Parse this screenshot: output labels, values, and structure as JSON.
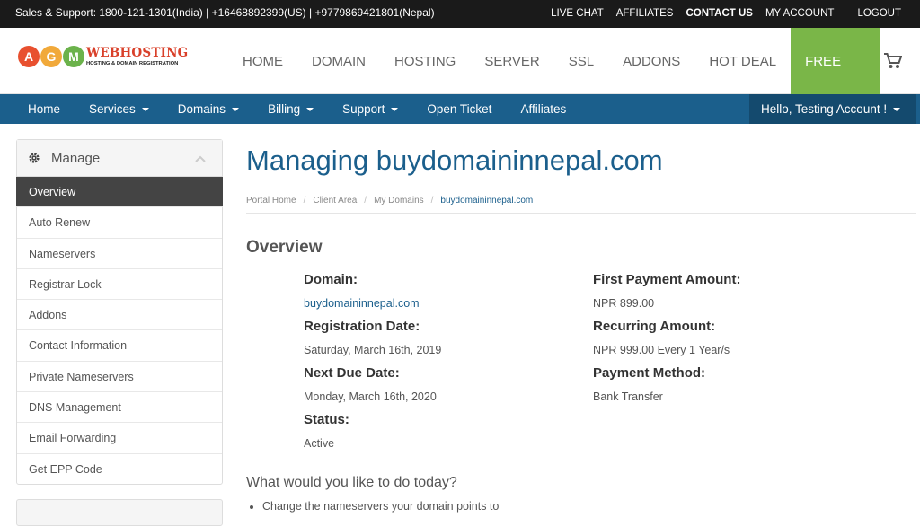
{
  "topbar": {
    "support": "Sales & Support: 1800-121-1301(India) | +16468892399(US) | +9779869421801(Nepal)",
    "links": [
      "LIVE CHAT",
      "AFFILIATES",
      "CONTACT US",
      "MY ACCOUNT",
      "LOGOUT"
    ]
  },
  "logo": {
    "letters": [
      "A",
      "G",
      "M"
    ],
    "letter_colors": [
      "#e8502f",
      "#f1a93a",
      "#6bb24b"
    ],
    "name": "WEBHOSTING",
    "tagline": "HOSTING & DOMAIN REGISTRATION"
  },
  "mainnav": [
    "HOME",
    "DOMAIN",
    "HOSTING",
    "SERVER",
    "SSL",
    "ADDONS",
    "HOT DEAL",
    "FREE TRAIL"
  ],
  "cart_icon": "cart-icon",
  "bluenav": {
    "items": [
      {
        "label": "Home",
        "dropdown": false
      },
      {
        "label": "Services",
        "dropdown": true
      },
      {
        "label": "Domains",
        "dropdown": true
      },
      {
        "label": "Billing",
        "dropdown": true
      },
      {
        "label": "Support",
        "dropdown": true
      },
      {
        "label": "Open Ticket",
        "dropdown": false
      },
      {
        "label": "Affiliates",
        "dropdown": false
      }
    ],
    "account": "Hello, Testing Account !"
  },
  "sidebar": {
    "title": "Manage",
    "items": [
      "Overview",
      "Auto Renew",
      "Nameservers",
      "Registrar Lock",
      "Addons",
      "Contact Information",
      "Private Nameservers",
      "DNS Management",
      "Email Forwarding",
      "Get EPP Code"
    ],
    "active": "Overview"
  },
  "page": {
    "title": "Managing buydomaininnepal.com",
    "breadcrumb": [
      "Portal Home",
      "Client Area",
      "My Domains",
      "buydomaininnepal.com"
    ],
    "section": "Overview",
    "domain_label": "Domain:",
    "domain_value": "buydomaininnepal.com",
    "reg_label": "Registration Date:",
    "reg_value": "Saturday, March 16th, 2019",
    "due_label": "Next Due Date:",
    "due_value": "Monday, March 16th, 2020",
    "status_label": "Status:",
    "status_value": "Active",
    "first_label": "First Payment Amount:",
    "first_value": "NPR 899.00",
    "recurring_label": "Recurring Amount:",
    "recurring_value": "NPR 999.00 Every 1 Year/s",
    "method_label": "Payment Method:",
    "method_value": "Bank Transfer",
    "question": "What would you like to do today?",
    "bullet": "Change the nameservers your domain points to"
  },
  "colors": {
    "topbar": "#1a1a1a",
    "bluenav": "#1b5f8c",
    "highlight": "#7ab648",
    "title": "#1b5f8c"
  }
}
